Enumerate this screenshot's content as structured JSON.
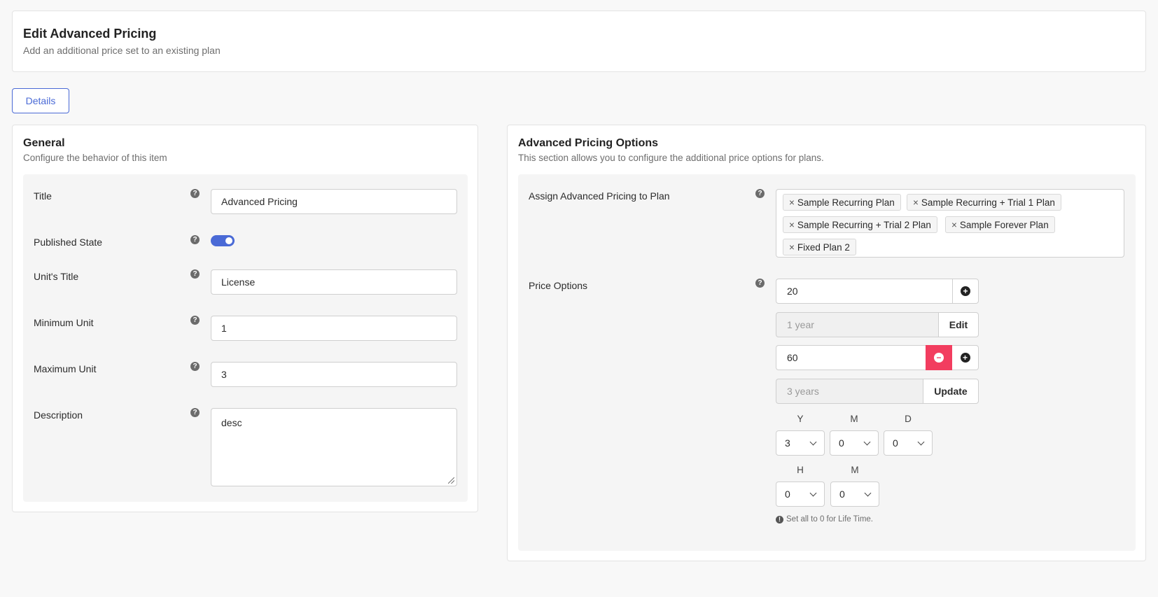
{
  "header": {
    "title": "Edit Advanced Pricing",
    "subtitle": "Add an additional price set to an existing plan"
  },
  "tabs": [
    {
      "label": "Details"
    }
  ],
  "general": {
    "title": "General",
    "subtitle": "Configure the behavior of this item",
    "fields": {
      "title": {
        "label": "Title",
        "value": "Advanced Pricing"
      },
      "published": {
        "label": "Published State",
        "value": true
      },
      "unit_title": {
        "label": "Unit's Title",
        "value": "License"
      },
      "min_unit": {
        "label": "Minimum Unit",
        "value": "1"
      },
      "max_unit": {
        "label": "Maximum Unit",
        "value": "3"
      },
      "description": {
        "label": "Description",
        "value": "desc"
      }
    }
  },
  "advanced": {
    "title": "Advanced Pricing Options",
    "subtitle": "This section allows you to configure the additional price options for plans.",
    "assign_label": "Assign Advanced Pricing to Plan",
    "plans": [
      "Sample Recurring Plan",
      "Sample Recurring + Trial 1 Plan",
      "Sample Recurring + Trial 2 Plan",
      "Sample Forever Plan",
      "Fixed Plan 2"
    ],
    "price_label": "Price Options",
    "price_rows": [
      {
        "price": "20",
        "duration": "1 year",
        "action": "Edit"
      },
      {
        "price": "60",
        "duration": "3 years",
        "action": "Update"
      }
    ],
    "duration_selects": {
      "y": {
        "label": "Y",
        "value": "3"
      },
      "m": {
        "label": "M",
        "value": "0"
      },
      "d": {
        "label": "D",
        "value": "0"
      },
      "h": {
        "label": "H",
        "value": "0"
      },
      "mi": {
        "label": "M",
        "value": "0"
      }
    },
    "note": "Set all to 0 for Life Time."
  },
  "colors": {
    "accent": "#4a6ad6",
    "danger": "#f23d5f"
  },
  "icons": {
    "help": "question-circle-icon",
    "add": "plus-circle-icon",
    "remove": "minus-circle-icon",
    "info": "info-circle-icon"
  }
}
